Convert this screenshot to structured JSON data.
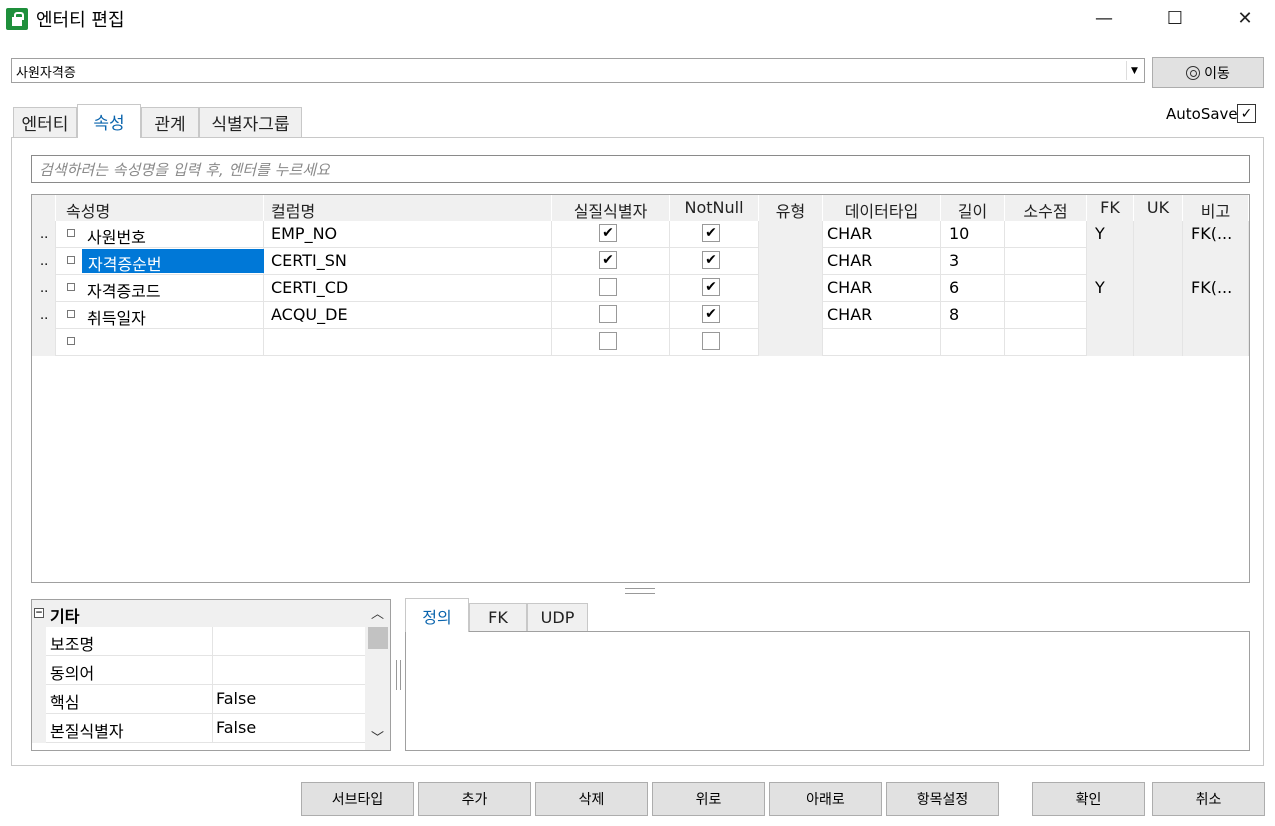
{
  "window": {
    "title": "엔터티 편집",
    "minimize": "—",
    "maximize": "☐",
    "close": "✕"
  },
  "entity_select": {
    "value": "사원자격증",
    "arrow": "▼"
  },
  "move_button": {
    "label": "이동"
  },
  "tabs": [
    {
      "label": "엔터티"
    },
    {
      "label": "속성"
    },
    {
      "label": "관계"
    },
    {
      "label": "식별자그룹"
    }
  ],
  "autosave": {
    "label": "AutoSave",
    "checked": "✓"
  },
  "search": {
    "placeholder": "검색하려는 속성명을 입력 후, 엔터를 누르세요"
  },
  "grid": {
    "headers": [
      "속성명",
      "컬럼명",
      "실질식별자",
      "NotNull",
      "유형",
      "데이터타입",
      "길이",
      "소수점",
      "FK",
      "UK",
      "비고"
    ],
    "rows": [
      {
        "marker": "..",
        "attr": "사원번호",
        "column": "EMP_NO",
        "pk": "✔",
        "notnull": "✔",
        "type": "",
        "datatype": "CHAR",
        "length": "10",
        "decimal": "",
        "fk": "Y",
        "uk": "",
        "note": "FK(..."
      },
      {
        "marker": "..",
        "attr": "자격증순번",
        "column": "CERTI_SN",
        "pk": "✔",
        "notnull": "✔",
        "type": "",
        "datatype": "CHAR",
        "length": "3",
        "decimal": "",
        "fk": "",
        "uk": "",
        "note": ""
      },
      {
        "marker": "..",
        "attr": "자격증코드",
        "column": "CERTI_CD",
        "pk": "",
        "notnull": "✔",
        "type": "",
        "datatype": "CHAR",
        "length": "6",
        "decimal": "",
        "fk": "Y",
        "uk": "",
        "note": "FK(..."
      },
      {
        "marker": "..",
        "attr": "취득일자",
        "column": "ACQU_DE",
        "pk": "",
        "notnull": "✔",
        "type": "",
        "datatype": "CHAR",
        "length": "8",
        "decimal": "",
        "fk": "",
        "uk": "",
        "note": ""
      },
      {
        "marker": "",
        "attr": "",
        "column": "",
        "pk": "",
        "notnull": "",
        "type": "",
        "datatype": "",
        "length": "",
        "decimal": "",
        "fk": "",
        "uk": "",
        "note": ""
      }
    ],
    "selected_row": 1,
    "highlight_color": "#ffff00",
    "selection_color": "#0078d7"
  },
  "properties": {
    "group": "기타",
    "collapse": "−",
    "rows": [
      {
        "name": "보조명",
        "value": ""
      },
      {
        "name": "동의어",
        "value": ""
      },
      {
        "name": "핵심",
        "value": "False"
      },
      {
        "name": "본질식별자",
        "value": "False"
      }
    ],
    "scroll_up": "︿",
    "scroll_down": "﹀"
  },
  "definition_tabs": [
    {
      "label": "정의"
    },
    {
      "label": "FK"
    },
    {
      "label": "UDP"
    }
  ],
  "buttons": {
    "subtype": "서브타입",
    "add": "추가",
    "delete": "삭제",
    "up": "위로",
    "down": "아래로",
    "item_settings": "항목설정",
    "ok": "확인",
    "cancel": "취소"
  }
}
